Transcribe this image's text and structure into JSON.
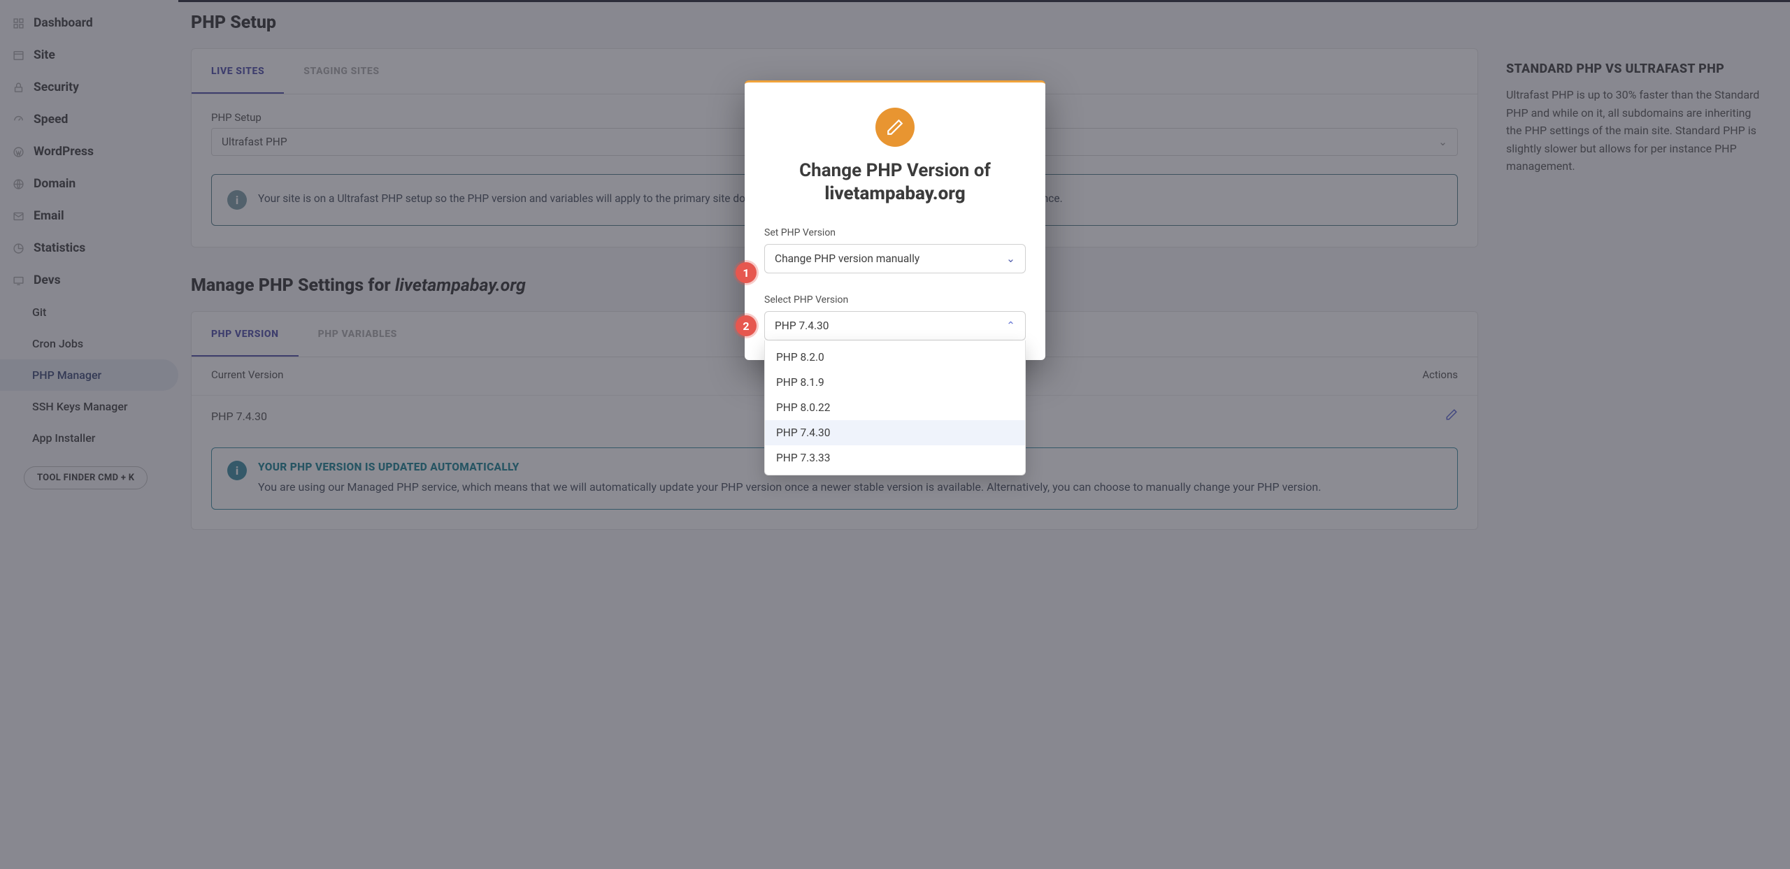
{
  "page": {
    "title": "PHP Setup"
  },
  "sidebar": {
    "items": [
      {
        "label": "Dashboard",
        "icon": "dashboard-icon"
      },
      {
        "label": "Site",
        "icon": "site-icon"
      },
      {
        "label": "Security",
        "icon": "security-icon"
      },
      {
        "label": "Speed",
        "icon": "speed-icon"
      },
      {
        "label": "WordPress",
        "icon": "wordpress-icon"
      },
      {
        "label": "Domain",
        "icon": "domain-icon"
      },
      {
        "label": "Email",
        "icon": "email-icon"
      },
      {
        "label": "Statistics",
        "icon": "statistics-icon"
      },
      {
        "label": "Devs",
        "icon": "devs-icon"
      }
    ],
    "subitems": [
      {
        "label": "Git"
      },
      {
        "label": "Cron Jobs"
      },
      {
        "label": "PHP Manager",
        "active": true
      },
      {
        "label": "SSH Keys Manager"
      },
      {
        "label": "App Installer"
      }
    ],
    "tool_finder": "TOOL FINDER CMD + K"
  },
  "php_setup": {
    "tabs": [
      {
        "label": "LIVE SITES",
        "active": true
      },
      {
        "label": "STAGING SITES"
      }
    ],
    "field_label": "PHP Setup",
    "select1": "Ultrafast PHP",
    "select2": "",
    "info_text": "Your site is on a Ultrafast PHP setup so the PHP version and variables will apply to the primary site domain. Switch to Standard PHP setup to manage PHP per instance."
  },
  "right_panel": {
    "title": "STANDARD PHP VS ULTRAFAST PHP",
    "body": "Ultrafast PHP is up to 30% faster than the Standard PHP and while on it, all subdomains are inheriting the PHP settings of the main site. Standard PHP is slightly slower but allows for per instance PHP management."
  },
  "manage": {
    "heading_prefix": "Manage PHP Settings for ",
    "heading_domain": "livetampabay.org",
    "tabs": [
      {
        "label": "PHP VERSION",
        "active": true
      },
      {
        "label": "PHP VARIABLES"
      }
    ],
    "col_left": "Current Version",
    "col_right": "Actions",
    "current_version": "PHP 7.4.30",
    "callout_title": "YOUR PHP VERSION IS UPDATED AUTOMATICALLY",
    "callout_body": "You are using our Managed PHP service, which means that we will automatically update your PHP version once a newer stable version is available. Alternatively, you can choose to manually change your PHP version."
  },
  "modal": {
    "title_prefix": "Change PHP Version of",
    "title_domain": "livetampabay.org",
    "field1_label": "Set PHP Version",
    "field1_value": "Change PHP version manually",
    "field2_label": "Select PHP Version",
    "field2_value": "PHP 7.4.30",
    "options": [
      {
        "label": "PHP 8.2.0"
      },
      {
        "label": "PHP 8.1.9"
      },
      {
        "label": "PHP 8.0.22"
      },
      {
        "label": "PHP 7.4.30",
        "selected": true
      },
      {
        "label": "PHP 7.3.33"
      }
    ],
    "badges": {
      "one": "1",
      "two": "2"
    }
  }
}
